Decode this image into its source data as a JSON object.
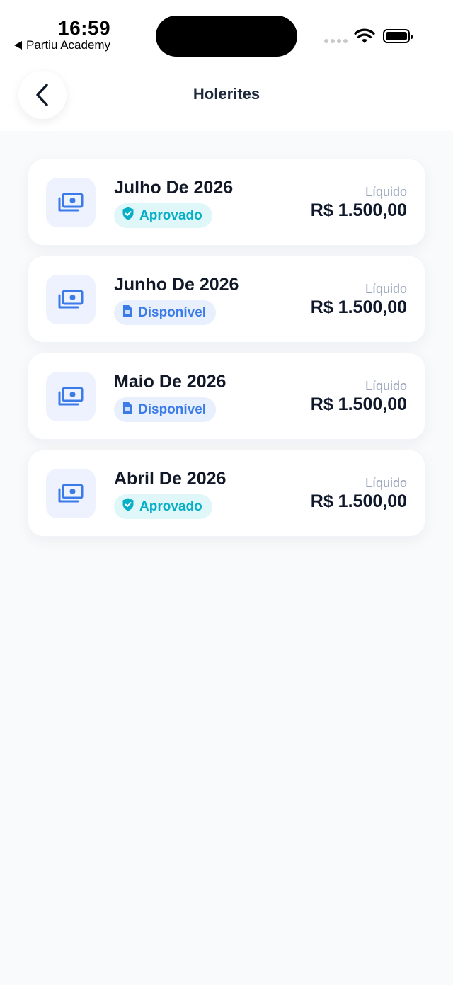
{
  "status_bar": {
    "time": "16:59",
    "back_app_label": "Partiu Academy"
  },
  "header": {
    "title": "Holerites",
    "back_icon": "chevron-left-icon"
  },
  "colors": {
    "approved_bg": "#e0f7fa",
    "approved_text": "#06aec6",
    "available_bg": "#e8f0fe",
    "available_text": "#3b7be8",
    "icon_tint": "#3b7be8"
  },
  "payslips": [
    {
      "month": "Julho De 2026",
      "status": "Aprovado",
      "status_type": "approved",
      "net_label": "Líquido",
      "amount": "R$ 1.500,00",
      "icon": "money-icon"
    },
    {
      "month": "Junho De 2026",
      "status": "Disponível",
      "status_type": "available",
      "net_label": "Líquido",
      "amount": "R$ 1.500,00",
      "icon": "money-icon"
    },
    {
      "month": "Maio De 2026",
      "status": "Disponível",
      "status_type": "available",
      "net_label": "Líquido",
      "amount": "R$ 1.500,00",
      "icon": "money-icon"
    },
    {
      "month": "Abril De 2026",
      "status": "Aprovado",
      "status_type": "approved",
      "net_label": "Líquido",
      "amount": "R$ 1.500,00",
      "icon": "money-icon"
    }
  ]
}
